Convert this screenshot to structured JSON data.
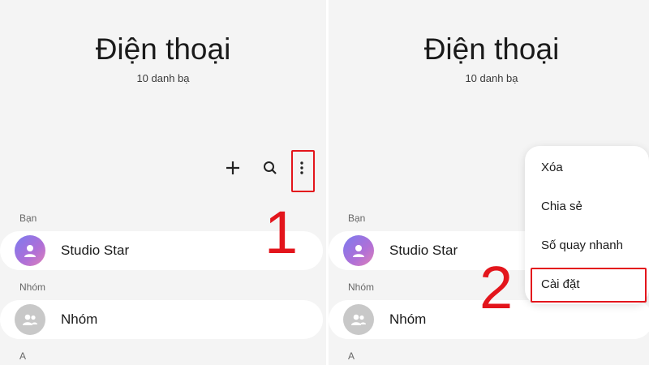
{
  "screen": {
    "title": "Điện thoại",
    "subtitle": "10 danh bạ"
  },
  "toolbar": {
    "add_icon": "plus-icon",
    "search_icon": "search-icon",
    "more_icon": "more-vertical-icon"
  },
  "sections": {
    "friends_label": "Bạn",
    "groups_label": "Nhóm",
    "alpha_label": "A"
  },
  "contacts": {
    "studio_star": "Studio Star",
    "group": "Nhóm"
  },
  "menu": {
    "items": [
      "Xóa",
      "Chia sẻ",
      "Số quay nhanh",
      "Cài đặt"
    ]
  },
  "annotations": {
    "step1": "1",
    "step2": "2",
    "highlight_color": "#e3151c"
  }
}
